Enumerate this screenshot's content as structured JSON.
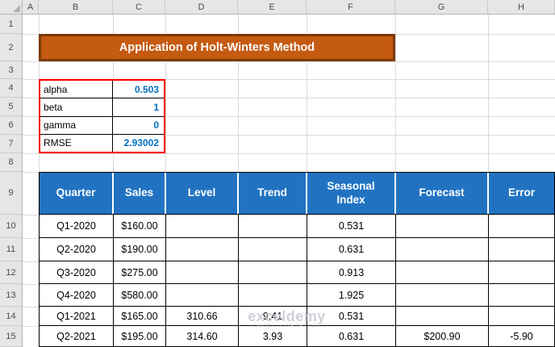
{
  "sheet": {
    "column_headers": [
      "A",
      "B",
      "C",
      "D",
      "E",
      "F",
      "G",
      "H"
    ],
    "row_headers": [
      "1",
      "2",
      "3",
      "4",
      "5",
      "6",
      "7",
      "8",
      "9",
      "10",
      "11",
      "12",
      "13",
      "14",
      "15"
    ]
  },
  "title_banner": {
    "text": "Application of Holt-Winters Method"
  },
  "parameters": {
    "rows": [
      {
        "label": "alpha",
        "value": "0.503"
      },
      {
        "label": "beta",
        "value": "1"
      },
      {
        "label": "gamma",
        "value": "0"
      },
      {
        "label": "RMSE",
        "value": "2.93002"
      }
    ]
  },
  "table": {
    "headers": [
      "Quarter",
      "Sales",
      "Level",
      "Trend",
      "Seasonal Index",
      "Forecast",
      "Error"
    ],
    "rows": [
      [
        "Q1-2020",
        "$160.00",
        "",
        "",
        "0.531",
        "",
        ""
      ],
      [
        "Q2-2020",
        "$190.00",
        "",
        "",
        "0.631",
        "",
        ""
      ],
      [
        "Q3-2020",
        "$275.00",
        "",
        "",
        "0.913",
        "",
        ""
      ],
      [
        "Q4-2020",
        "$580.00",
        "",
        "",
        "1.925",
        "",
        ""
      ],
      [
        "Q1-2021",
        "$165.00",
        "310.66",
        "9.41",
        "0.531",
        "",
        ""
      ],
      [
        "Q2-2021",
        "$195.00",
        "314.60",
        "3.93",
        "0.631",
        "$200.90",
        "-5.90"
      ]
    ]
  },
  "watermark": {
    "text": "exceldemy",
    "subtext": "EXCEL · DATA · BI"
  },
  "colors": {
    "title_bg": "#C55A11",
    "title_border": "#7B3A05",
    "table_header_bg": "#2173C2",
    "param_value_text": "#0070C0",
    "param_border": "#FF0000",
    "gridline": "#DADADA"
  }
}
